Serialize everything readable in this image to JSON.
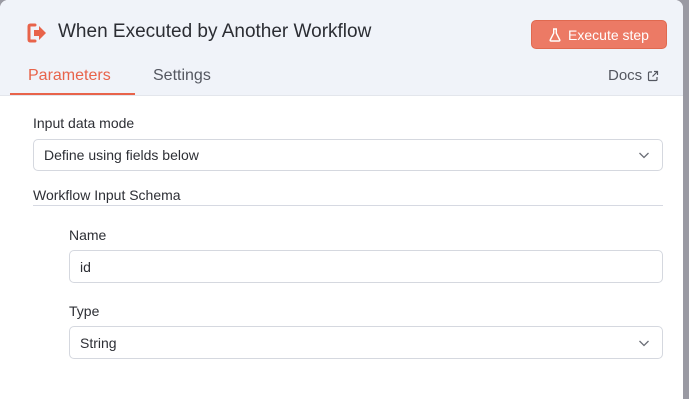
{
  "header": {
    "title": "When Executed by Another Workflow",
    "title_icon": "sign-in-arrow-icon",
    "execute_label": "Execute step",
    "execute_icon": "flask-icon"
  },
  "tabs": [
    {
      "label": "Parameters",
      "active": true
    },
    {
      "label": "Settings",
      "active": false
    }
  ],
  "docs": {
    "label": "Docs",
    "icon": "external-link-icon"
  },
  "params": {
    "input_mode_label": "Input data mode",
    "input_mode_value": "Define using fields below",
    "schema_title": "Workflow Input Schema",
    "name_label": "Name",
    "name_value": "id",
    "type_label": "Type",
    "type_value": "String"
  },
  "colors": {
    "accent": "#e8634a",
    "button": "#ec7a65",
    "header_bg": "#f0f3f9"
  }
}
